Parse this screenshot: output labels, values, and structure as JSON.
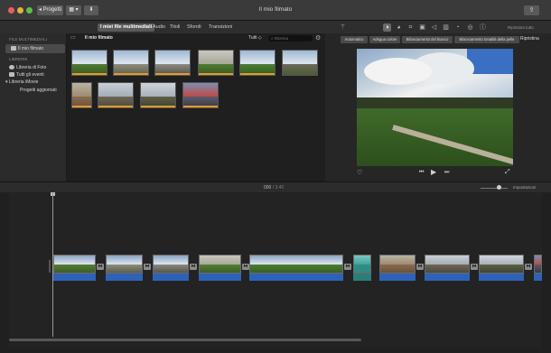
{
  "titlebar": {
    "title": "Il mio filmato",
    "projects_label": "◂ Progetti",
    "view_icon": "▦ ▾",
    "import_icon": "⬇",
    "share_icon": "⇪"
  },
  "tabs": [
    {
      "label": "I miei file multimediali",
      "active": true
    },
    {
      "label": "Audio",
      "active": false
    },
    {
      "label": "Titoli",
      "active": false
    },
    {
      "label": "Sfondi",
      "active": false
    },
    {
      "label": "Transizioni",
      "active": false
    }
  ],
  "tools": {
    "reset_all": "Ripristina tutto",
    "icons": [
      "magic-wand-icon",
      "color-balance-icon",
      "color-correction-icon",
      "crop-icon",
      "stabilization-icon",
      "volume-icon",
      "equalizer-icon",
      "speed-icon",
      "filter-icon",
      "info-icon"
    ]
  },
  "sidebar": {
    "heading_media": "FILE MULTIMEDIALI",
    "selected_item": "Il mio filmato",
    "heading_libraries": "LIBRERIE",
    "items": [
      {
        "label": "Libreria di Foto"
      },
      {
        "label": "Tutti gli eventi"
      },
      {
        "label": "Libreria iMovie"
      },
      {
        "label": "Progetti aggiornati"
      }
    ]
  },
  "browser": {
    "title": "Il mio filmato",
    "filter": "Tutti ◇",
    "search_placeholder": "Ricerca",
    "clips_row1": 6,
    "clips_row2": 4
  },
  "adjust": {
    "buttons": [
      "Automatico",
      "Adegua colore",
      "Bilanciamento del bianco",
      "Bilanciamento tonalità della pelle"
    ],
    "reset": "Ripristina"
  },
  "timeline": {
    "timecode": "000",
    "duration": "/ 3:40",
    "settings": "Impostazioni"
  }
}
